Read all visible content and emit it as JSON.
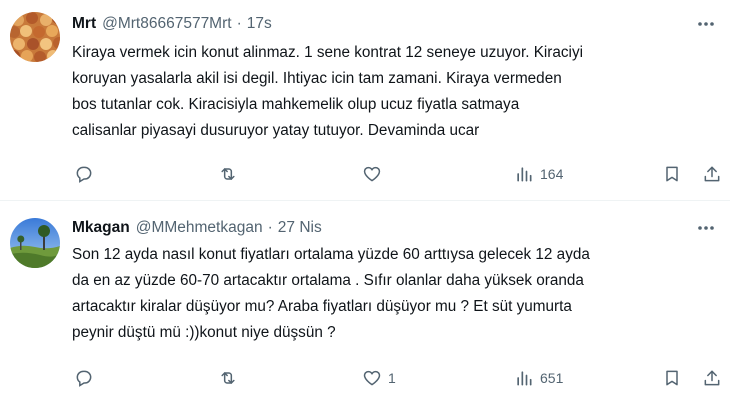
{
  "tweets": [
    {
      "name": "Mrt",
      "handle": "@Mrt86667577Mrt",
      "dot": "·",
      "time": "17s",
      "text": "Kiraya vermek icin konut alinmaz. 1 sene kontrat 12 seneye uzuyor. Kiraciyi\nkoruyan yasalarla akil isi degil. Ihtiyac icin tam zamani. Kiraya vermeden\nbos tutanlar cok. Kiracisiyla mahkemelik olup ucuz fiyatla satmaya\ncalisanlar piyasayi dusuruyor yatay tutuyor. Devaminda ucar",
      "replies": "",
      "retweets": "",
      "likes": "",
      "views": "164"
    },
    {
      "name": "Mkagan",
      "handle": "@MMehmetkagan",
      "dot": "·",
      "time": "27 Nis",
      "text": "Son 12 ayda nasıl konut fiyatları ortalama yüzde 60 arttıysa gelecek 12 ayda\nda en az yüzde 60-70 artacaktır ortalama . Sıfır olanlar daha yüksek oranda\nartacaktır kiralar düşüyor mu? Araba fiyatları düşüyor mu ? Et süt yumurta\npeynir düştü mü :))konut niye düşsün ?",
      "replies": "",
      "retweets": "",
      "likes": "1",
      "views": "651"
    }
  ],
  "icons": {
    "more": "more-horizontal-icon",
    "reply": "reply-icon",
    "retweet": "retweet-icon",
    "like": "heart-icon",
    "views": "views-icon",
    "bookmark": "bookmark-icon",
    "share": "share-icon"
  },
  "colors": {
    "text": "#0f1419",
    "secondary": "#536471",
    "divider": "#eff3f4"
  }
}
